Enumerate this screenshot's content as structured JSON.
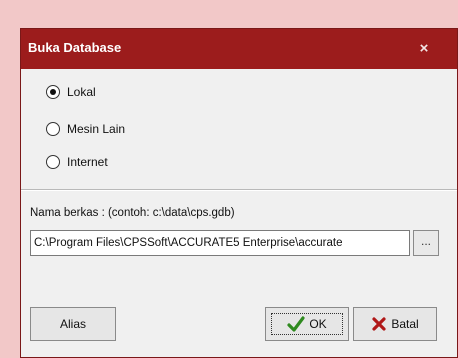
{
  "dialog": {
    "title": "Buka Database",
    "close_glyph": "×"
  },
  "radios": [
    {
      "label": "Lokal",
      "checked": true
    },
    {
      "label": "Mesin Lain",
      "checked": false
    },
    {
      "label": "Internet",
      "checked": false
    }
  ],
  "file": {
    "label": "Nama berkas :  (contoh: c:\\data\\cps.gdb)",
    "value": "C:\\Program Files\\CPSSoft\\ACCURATE5 Enterprise\\accurate",
    "browse_label": "..."
  },
  "buttons": {
    "alias_label": "Alias",
    "ok_label": "OK",
    "cancel_label": "Batal"
  },
  "colors": {
    "titlebar": "#9c1c1c",
    "ok_check": "#2f8a1f",
    "cancel_x": "#b01818"
  },
  "icons": {
    "close": "close-icon",
    "ok": "checkmark-icon",
    "cancel": "x-icon"
  }
}
